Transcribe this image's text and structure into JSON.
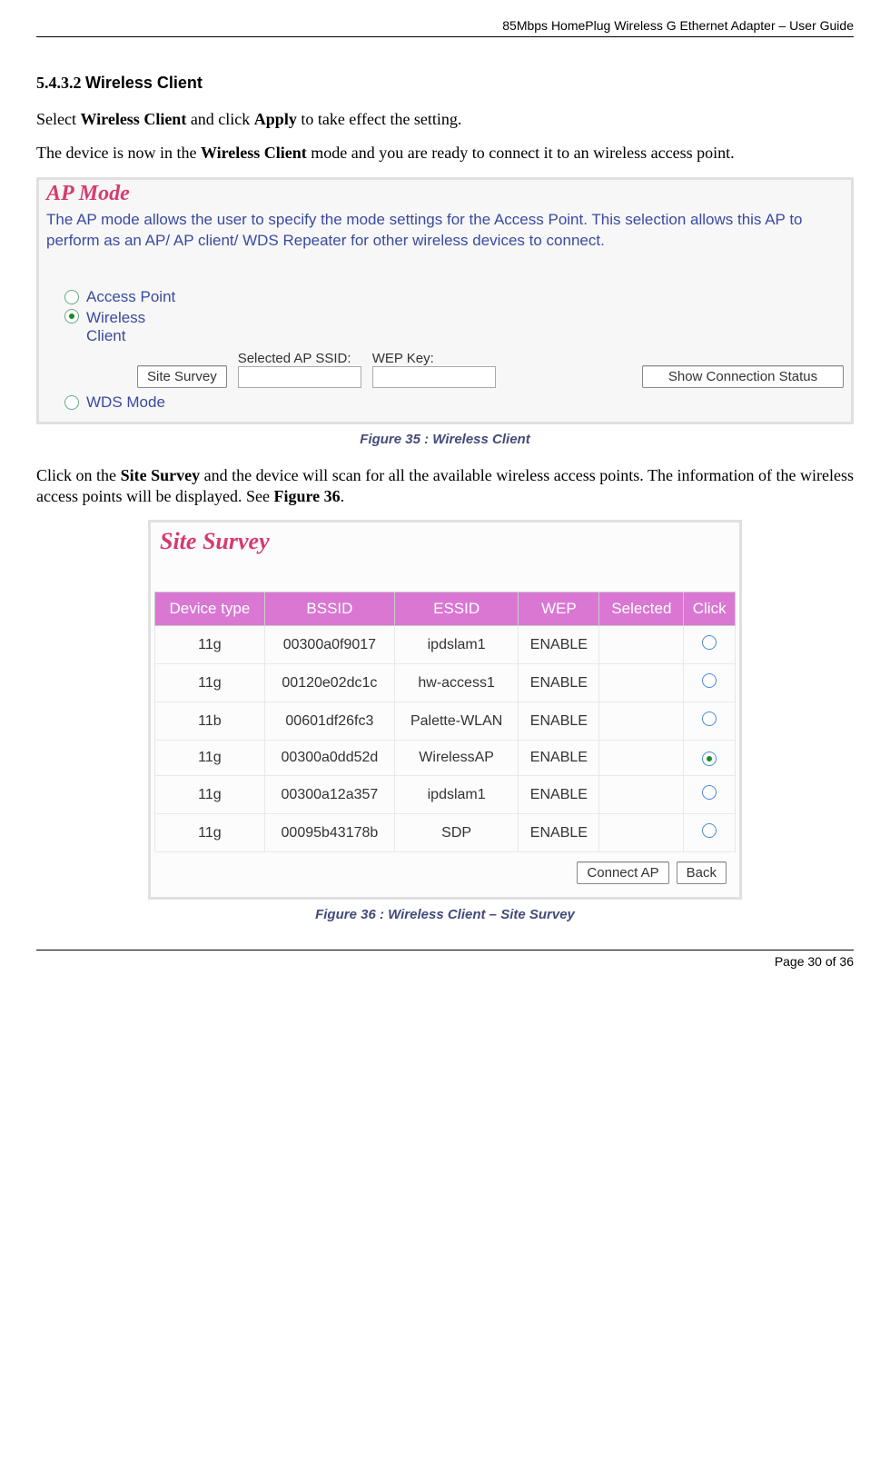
{
  "header": "85Mbps HomePlug Wireless G Ethernet Adapter – User Guide",
  "section_num": "5.4.3.2",
  "section_title": "Wireless Client",
  "p1a": "Select ",
  "p1b": "Wireless Client",
  "p1c": " and click ",
  "p1d": "Apply",
  "p1e": " to take effect the setting.",
  "p2a": "The device is now in the ",
  "p2b": "Wireless Client",
  "p2c": " mode and you are ready to connect it to an wireless access point.",
  "fig35": {
    "title": "AP Mode",
    "desc": "The AP mode allows the user to specify the mode settings for the Access Point. This selection allows this AP to perform as an AP/ AP client/ WDS Repeater for other wireless devices to connect.",
    "opt1": "Access Point",
    "opt2a": "Wireless",
    "opt2b": "Client",
    "opt3": "WDS Mode",
    "btn_site": "Site Survey",
    "lbl_ssid": "Selected AP SSID:",
    "lbl_wep": "WEP Key:",
    "btn_status": "Show Connection Status"
  },
  "caption35": "Figure 35 : Wireless Client",
  "p3a": "Click on the ",
  "p3b": "Site Survey",
  "p3c": " and the device will scan for all the available wireless access points. The information of the wireless access points will be displayed. See ",
  "p3d": "Figure 36",
  "p3e": ".",
  "fig36": {
    "title": "Site Survey",
    "headers": [
      "Device type",
      "BSSID",
      "ESSID",
      "WEP",
      "Selected",
      "Click"
    ],
    "rows": [
      {
        "dt": "11g",
        "bssid": "00300a0f9017",
        "essid": "ipdslam1",
        "wep": "ENABLE",
        "sel": false
      },
      {
        "dt": "11g",
        "bssid": "00120e02dc1c",
        "essid": "hw-access1",
        "wep": "ENABLE",
        "sel": false
      },
      {
        "dt": "11b",
        "bssid": "00601df26fc3",
        "essid": "Palette-WLAN",
        "wep": "ENABLE",
        "sel": false
      },
      {
        "dt": "11g",
        "bssid": "00300a0dd52d",
        "essid": "WirelessAP",
        "wep": "ENABLE",
        "sel": true
      },
      {
        "dt": "11g",
        "bssid": "00300a12a357",
        "essid": "ipdslam1",
        "wep": "ENABLE",
        "sel": false
      },
      {
        "dt": "11g",
        "bssid": "00095b43178b",
        "essid": "SDP",
        "wep": "ENABLE",
        "sel": false
      }
    ],
    "btn_connect": "Connect AP",
    "btn_back": "Back"
  },
  "caption36": "Figure 36 : Wireless Client – Site Survey",
  "footer": "Page 30 of 36"
}
